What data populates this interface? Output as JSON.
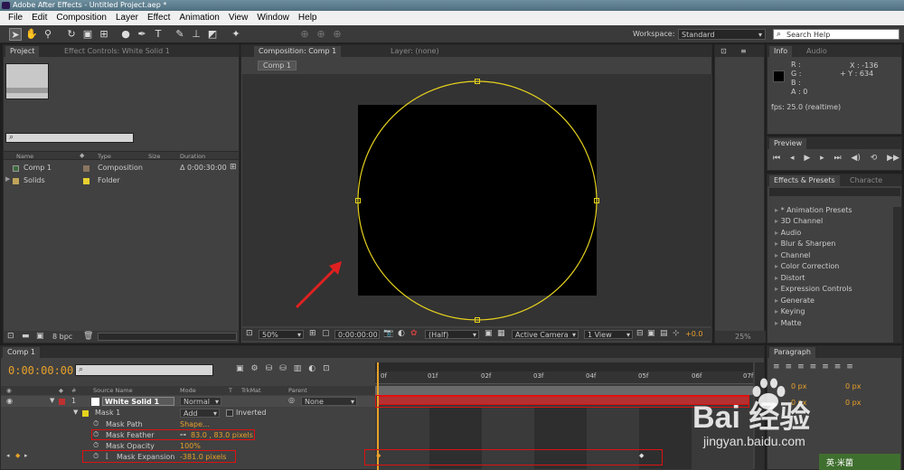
{
  "window": {
    "title": "Adobe After Effects - Untitled Project.aep *"
  },
  "menu": [
    "File",
    "Edit",
    "Composition",
    "Layer",
    "Effect",
    "Animation",
    "View",
    "Window",
    "Help"
  ],
  "workspace": {
    "label": "Workspace:",
    "value": "Standard"
  },
  "search_help": {
    "placeholder": "Search Help"
  },
  "project": {
    "tabs": [
      "Project",
      "Effect Controls: White Solid 1"
    ],
    "search_glyph": "⌕",
    "columns": [
      "Name",
      "Type",
      "Size",
      "Duration"
    ],
    "items": [
      {
        "name": "Comp 1",
        "type": "Composition",
        "duration": "Δ 0:00:30:00",
        "label_color": "#8a7560"
      },
      {
        "name": "Solids",
        "type": "Folder",
        "duration": "",
        "label_color": "#e8d030"
      }
    ],
    "bpc": "8 bpc"
  },
  "composition": {
    "tabs": [
      "Composition: Comp 1",
      "Layer: (none)"
    ],
    "crumb": "Comp 1",
    "zoom": "50%",
    "timecode": "0:00:00:00",
    "resolution": "(Half)",
    "camera": "Active Camera",
    "views": "1 View",
    "exposure": "+0.0",
    "zoom_right": "25%",
    "mask_color": "#e6d21e",
    "solid_color": "#000000"
  },
  "info": {
    "tabs": [
      "Info",
      "Audio"
    ],
    "r": "R :",
    "g": "G :",
    "b": "B :",
    "a": "A : 0",
    "x": "X : -136",
    "y": "+ Y : 634",
    "fps": "fps: 25.0 (realtime)"
  },
  "preview": {
    "tab": "Preview"
  },
  "effects": {
    "tabs": [
      "Effects & Presets",
      "Characte"
    ],
    "items": [
      "* Animation Presets",
      "3D Channel",
      "Audio",
      "Blur & Sharpen",
      "Channel",
      "Color Correction",
      "Distort",
      "Expression Controls",
      "Generate",
      "Keying",
      "Matte"
    ]
  },
  "paragraph": {
    "tab": "Paragraph",
    "px1": "0 px",
    "px2": "0 px",
    "px3": "0 px",
    "px4": "0 px"
  },
  "timeline": {
    "tab": "Comp 1",
    "timecode": "0:00:00:00",
    "columns": {
      "hash": "#",
      "source": "Source Name",
      "mode": "Mode",
      "t": "T",
      "trkmat": "TrkMat",
      "parent": "Parent"
    },
    "layer": {
      "num": "1",
      "name": "White Solid 1",
      "mode": "Normal",
      "parent": "None"
    },
    "mask": {
      "name": "Mask 1",
      "mode": "Add",
      "inverted": "Inverted"
    },
    "props": [
      {
        "label": "Mask Path",
        "value": "Shape..."
      },
      {
        "label": "Mask Feather",
        "value": "83.0 , 83.0 pixels"
      },
      {
        "label": "Mask Opacity",
        "value": "100%"
      },
      {
        "label": "Mask Expansion",
        "value": "-381.0 pixels"
      }
    ],
    "ruler": [
      "0f",
      "01f",
      "02f",
      "03f",
      "04f",
      "05f",
      "06f",
      "07f"
    ]
  },
  "watermark": {
    "brand": "Bai 经验",
    "url": "jingyan.baidu.com",
    "corner": "英·米菌"
  }
}
